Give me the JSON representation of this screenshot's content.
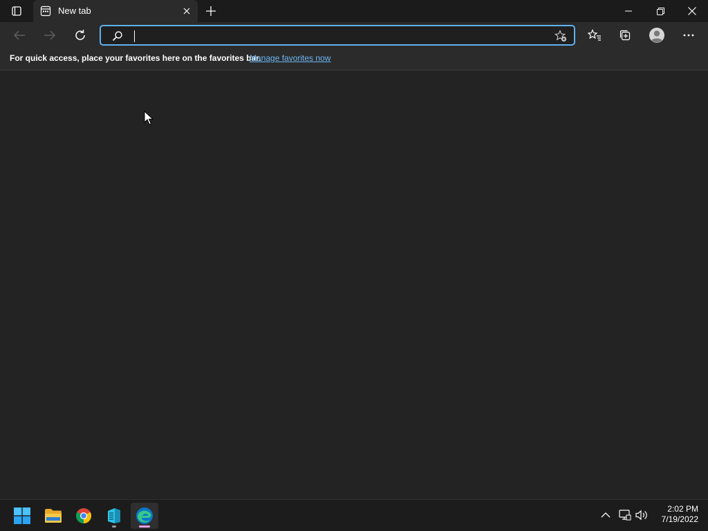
{
  "browser": {
    "tab_title": "New tab",
    "address_placeholder": "",
    "address_value": ""
  },
  "favorites_bar": {
    "message": "For quick access, place your favorites here on the favorites bar.",
    "link_label": "Manage favorites now"
  },
  "taskbar": {
    "time": "2:02 PM",
    "date": "7/19/2022",
    "apps": [
      "start-icon",
      "file-explorer-icon",
      "chrome-icon",
      "tool-icon",
      "edge-icon"
    ]
  },
  "colors": {
    "accent": "#5fb2f2",
    "link": "#6cb8f5",
    "background": "#232323"
  }
}
